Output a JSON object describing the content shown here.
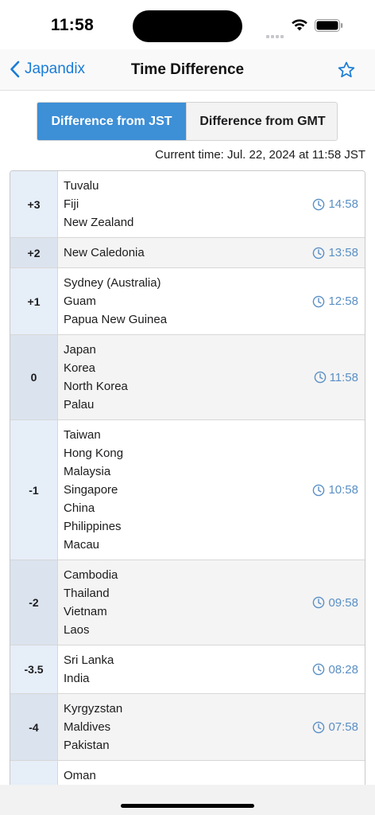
{
  "status": {
    "time": "11:58"
  },
  "nav": {
    "back_label": "Japandix",
    "title": "Time Difference"
  },
  "segments": {
    "jst": "Difference from JST",
    "gmt": "Difference from GMT"
  },
  "current_time": "Current time: Jul. 22, 2024 at 11:58 JST",
  "rows": [
    {
      "offset": "+3",
      "countries": [
        "Tuvalu",
        "Fiji",
        "New Zealand"
      ],
      "time": "14:58"
    },
    {
      "offset": "+2",
      "countries": [
        "New Caledonia"
      ],
      "time": "13:58"
    },
    {
      "offset": "+1",
      "countries": [
        "Sydney (Australia)",
        "Guam",
        "Papua New Guinea"
      ],
      "time": "12:58"
    },
    {
      "offset": "0",
      "countries": [
        "Japan",
        "Korea",
        "North Korea",
        "Palau"
      ],
      "time": "11:58"
    },
    {
      "offset": "-1",
      "countries": [
        "Taiwan",
        "Hong Kong",
        "Malaysia",
        "Singapore",
        "China",
        "Philippines",
        "Macau"
      ],
      "time": "10:58"
    },
    {
      "offset": "-2",
      "countries": [
        "Cambodia",
        "Thailand",
        "Vietnam",
        "Laos"
      ],
      "time": "09:58"
    },
    {
      "offset": "-3.5",
      "countries": [
        "Sri Lanka",
        "India"
      ],
      "time": "08:28"
    },
    {
      "offset": "-4",
      "countries": [
        "Kyrgyzstan",
        "Maldives",
        "Pakistan"
      ],
      "time": "07:58"
    },
    {
      "offset": "",
      "countries": [
        "Oman"
      ],
      "time": ""
    }
  ],
  "icons": {
    "back": "chevron-left-icon",
    "favorite": "star-icon",
    "clock": "clock-icon"
  },
  "colors": {
    "accent": "#1a7cd6",
    "segment_active": "#3d8fd6",
    "time_text": "#5a8fc4"
  }
}
